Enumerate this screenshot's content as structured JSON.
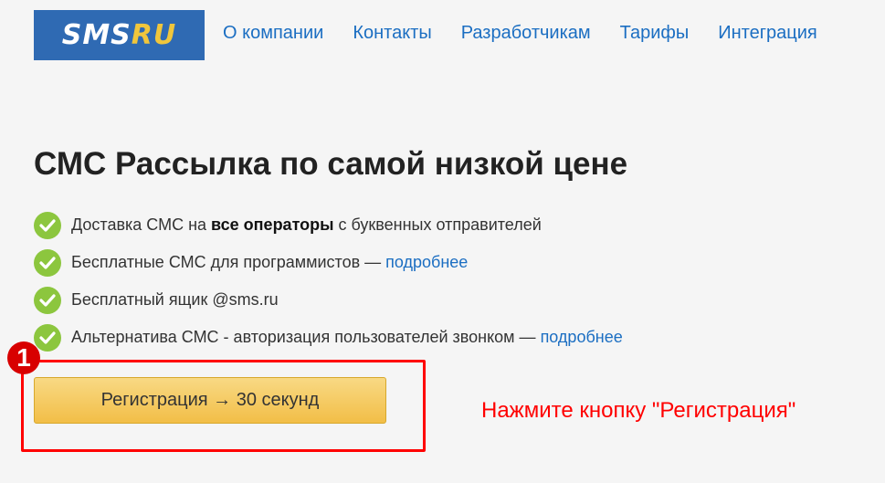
{
  "logo": {
    "main": "SMS",
    "accent": "RU"
  },
  "nav": [
    {
      "label": "О компании"
    },
    {
      "label": "Контакты"
    },
    {
      "label": "Разработчикам"
    },
    {
      "label": "Тарифы"
    },
    {
      "label": "Интеграция"
    }
  ],
  "title": "СМС Рассылка по самой низкой цене",
  "features": [
    {
      "before": "Доставка СМС на ",
      "bold": "все операторы",
      "after": " с буквенных отправителей",
      "link": ""
    },
    {
      "before": "Бесплатные СМС для программистов — ",
      "bold": "",
      "after": "",
      "link": "подробнее"
    },
    {
      "before": "Бесплатный ящик @sms.ru",
      "bold": "",
      "after": "",
      "link": ""
    },
    {
      "before": "Альтернатива СМС - авторизация пользователей звонком — ",
      "bold": "",
      "after": "",
      "link": "подробнее"
    }
  ],
  "register_button": "Регистрация → 30 секунд",
  "annotation": {
    "number": "1",
    "hint": "Нажмите кнопку \"Регистрация\""
  },
  "colors": {
    "logo_bg": "#2f6ab3",
    "logo_accent": "#f0c63c",
    "link": "#1b6ec2",
    "check": "#8cc63e",
    "button": "#f2be47",
    "annotation": "#ff0000"
  }
}
